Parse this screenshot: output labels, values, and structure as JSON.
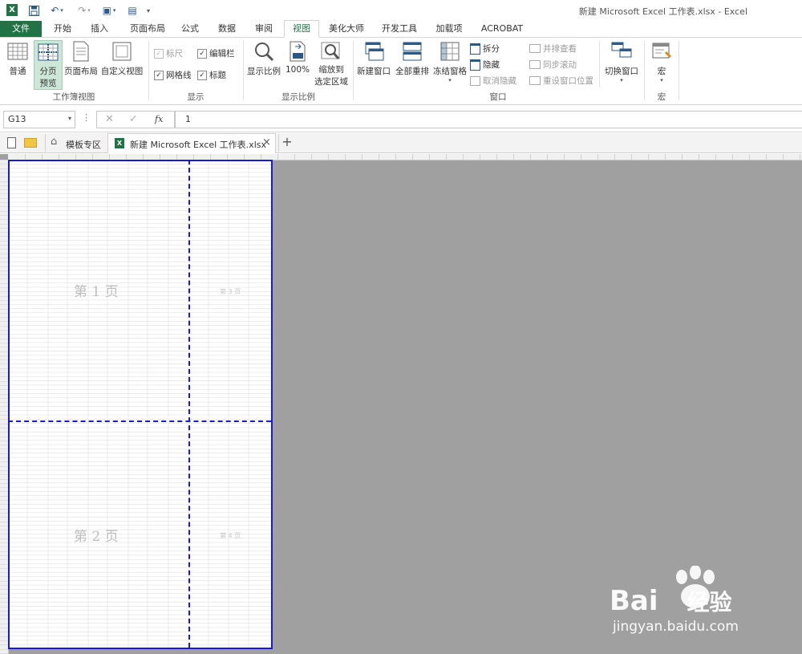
{
  "window": {
    "title": "新建 Microsoft Excel 工作表.xlsx - Excel"
  },
  "ribbon_tabs": [
    "文件",
    "开始",
    "插入",
    "页面布局",
    "公式",
    "数据",
    "审阅",
    "视图",
    "美化大师",
    "开发工具",
    "加载项",
    "ACROBAT"
  ],
  "active_tab": "视图",
  "ribbon": {
    "workbook_views": {
      "label": "工作簿视图",
      "normal": "普通",
      "page_break_1": "分页",
      "page_break_2": "预览",
      "page_layout": "页面布局",
      "custom_views": "自定义视图"
    },
    "show": {
      "label": "显示",
      "ruler": "标尺",
      "formula_bar": "编辑栏",
      "gridlines": "网格线",
      "headings": "标题"
    },
    "zoom": {
      "label": "显示比例",
      "zoom": "显示比例",
      "hundred": "100%",
      "selection_1": "缩放到",
      "selection_2": "选定区域"
    },
    "window": {
      "label": "窗口",
      "new_window": "新建窗口",
      "arrange_all": "全部重排",
      "freeze_panes": "冻结窗格",
      "split": "拆分",
      "hide": "隐藏",
      "unhide": "取消隐藏",
      "side_by_side": "并排查看",
      "sync_scroll": "同步滚动",
      "reset_position": "重设窗口位置",
      "switch_windows": "切换窗口"
    },
    "macros": {
      "label": "宏",
      "macros": "宏"
    }
  },
  "formula_bar": {
    "name_box": "G13",
    "fx": "fx",
    "value": "1"
  },
  "file_tabs": {
    "templates": "模板专区",
    "workbook": "新建 Microsoft Excel 工作表.xlsx",
    "close": "×",
    "add": "+"
  },
  "pages": {
    "page1": "第 1 页",
    "page2": "第 2 页",
    "page3": "第 3 页",
    "page4": "第 4 页"
  },
  "watermark": {
    "brand": "Bai",
    "brand2": "经验",
    "url": "jingyan.baidu.com"
  },
  "colors": {
    "excel_green": "#217346",
    "page_break_blue": "#1a1acf",
    "canvas_gray": "#a0a0a0"
  }
}
